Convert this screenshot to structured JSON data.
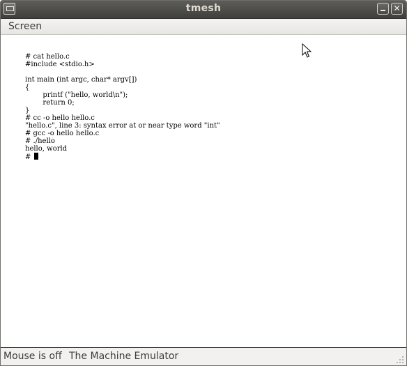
{
  "window": {
    "title": "tmesh",
    "minimize_glyph": "",
    "close_glyph": "✕"
  },
  "menubar": {
    "items": [
      {
        "label": "Screen"
      }
    ]
  },
  "terminal": {
    "lines": [
      "# cat hello.c",
      "#include <stdio.h>",
      "",
      "int main (int argc, char* argv[])",
      "{",
      "        printf (\"hello, world\\n\");",
      "        return 0;",
      "}",
      "# cc -o hello hello.c",
      "\"hello.c\", line 3: syntax error at or near type word \"int\"",
      "# gcc -o hello hello.c",
      "# ./hello",
      "hello, world",
      "# "
    ],
    "cursor": "block"
  },
  "statusbar": {
    "mouse_status": "Mouse is off",
    "machine_label": "The Machine Emulator"
  },
  "icons": {
    "window_menu": "window-menu-icon",
    "minimize": "minimize-icon",
    "close": "close-icon",
    "mouse_pointer": "mouse-pointer-icon",
    "resize_grip": "resize-grip-icon"
  },
  "colors": {
    "titlebar": "#4a4945",
    "title_text": "#dfdbd2",
    "chrome": "#f2f1f0",
    "screen_bg": "#ffffff",
    "terminal_text": "#000000"
  }
}
